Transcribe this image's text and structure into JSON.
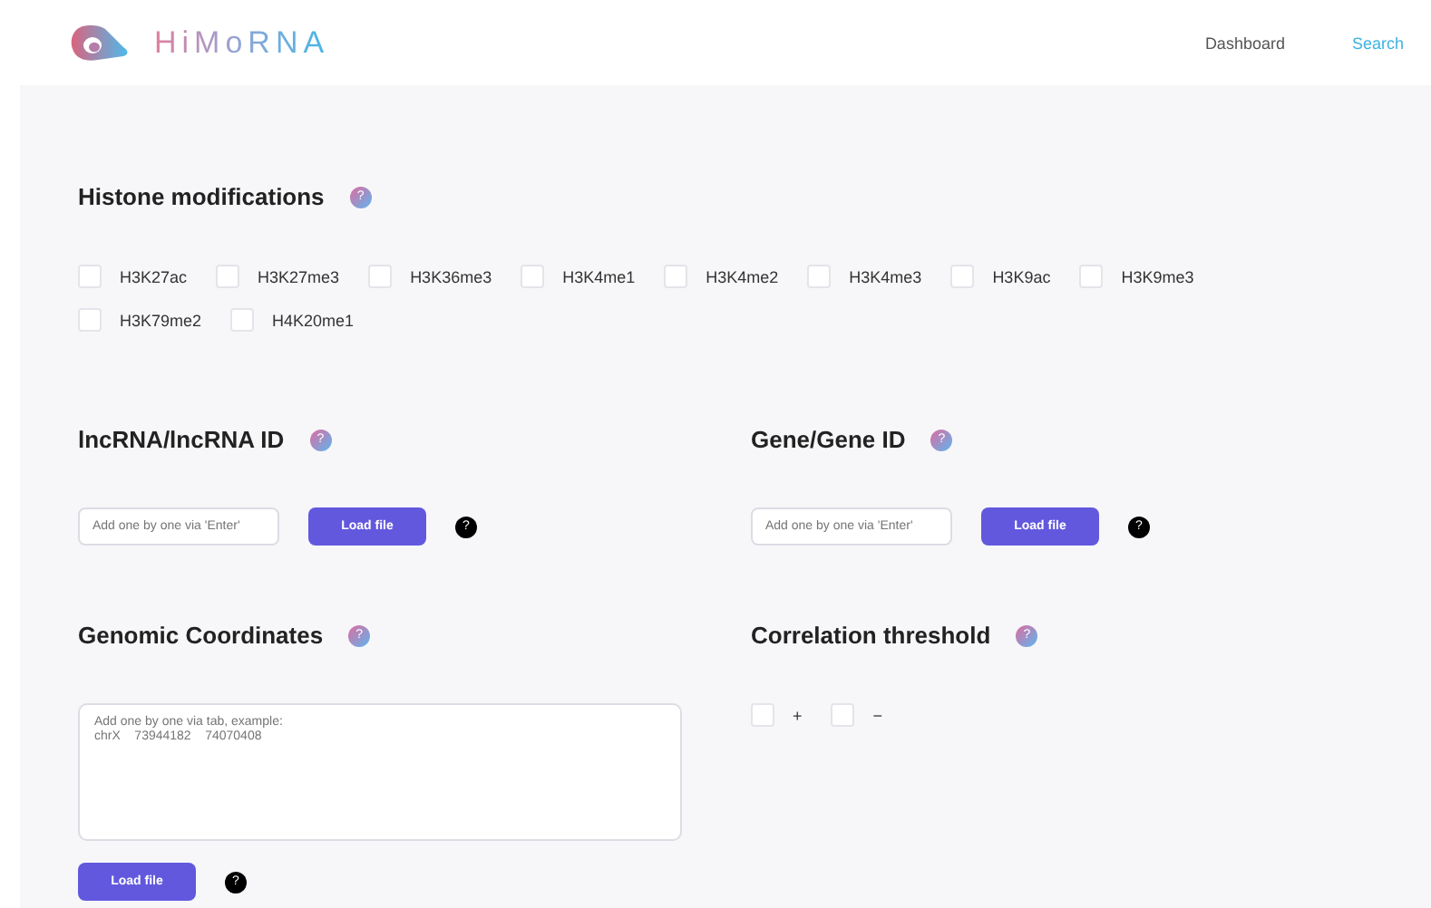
{
  "header": {
    "logo_text": "HiMoRNA",
    "nav": [
      {
        "label": "Dashboard",
        "selected": false
      },
      {
        "label": "Search",
        "selected": true
      }
    ]
  },
  "histone": {
    "title": "Histone modifications",
    "help": "?",
    "options": [
      {
        "label": "H3K27ac",
        "checked": false
      },
      {
        "label": "H3K27me3",
        "checked": false
      },
      {
        "label": "H3K36me3",
        "checked": false
      },
      {
        "label": "H3K4me1",
        "checked": false
      },
      {
        "label": "H3K4me2",
        "checked": false
      },
      {
        "label": "H3K4me3",
        "checked": false
      },
      {
        "label": "H3K9ac",
        "checked": false
      },
      {
        "label": "H3K9me3",
        "checked": false
      },
      {
        "label": "H3K79me2",
        "checked": false
      },
      {
        "label": "H4K20me1",
        "checked": false
      }
    ]
  },
  "lncrna": {
    "title": "lncRNA/lncRNA ID",
    "help": "?",
    "placeholder": "Add one by one via 'Enter'",
    "button": "Load file",
    "button_help": "?"
  },
  "gene": {
    "title": "Gene/Gene ID",
    "help": "?",
    "placeholder": "Add one by one via 'Enter'",
    "button": "Load file",
    "button_help": "?"
  },
  "coordinates": {
    "title": "Genomic Coordinates",
    "help": "?",
    "placeholder": "Add one by one via tab, example:\nchrX    73944182    74070408",
    "button": "Load file",
    "button_help": "?"
  },
  "correlation": {
    "title": "Correlation threshold",
    "help": "?",
    "options": [
      {
        "label": "+",
        "checked": false
      },
      {
        "label": "−",
        "checked": false
      }
    ]
  }
}
